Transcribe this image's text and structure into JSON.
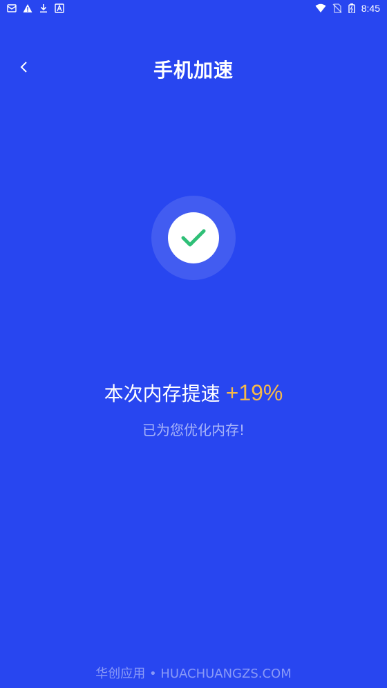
{
  "status_bar": {
    "time": "8:45",
    "left_icons": [
      "mail-icon",
      "warning-icon",
      "download-icon",
      "a-icon"
    ],
    "right_icons": [
      "wifi-icon",
      "no-sim-icon",
      "battery-icon"
    ]
  },
  "header": {
    "title": "手机加速"
  },
  "result": {
    "label": "本次内存提速",
    "percent": "+19%",
    "subtitle": "已为您优化内存!"
  },
  "footer": {
    "text": "华创应用 • HUACHUANGZS.COM"
  },
  "colors": {
    "background": "#2846f0",
    "accent": "#f7b948",
    "check": "#2fbf77"
  }
}
